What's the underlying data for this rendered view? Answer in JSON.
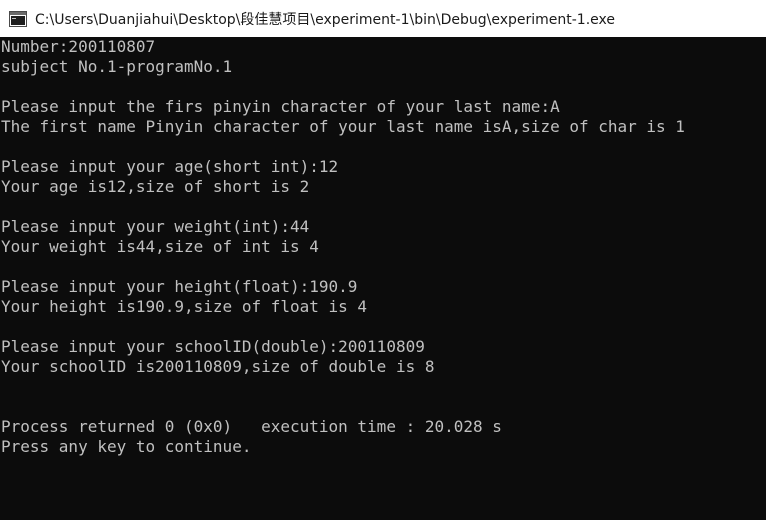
{
  "window": {
    "title": "C:\\Users\\Duanjiahui\\Desktop\\段佳慧项目\\experiment-1\\bin\\Debug\\experiment-1.exe",
    "icon": "console-window-icon"
  },
  "console": {
    "lines": [
      "Number:200110807",
      "subject No.1-programNo.1",
      "",
      "Please input the firs pinyin character of your last name:A",
      "The first name Pinyin character of your last name isA,size of char is 1",
      "",
      "Please input your age(short int):12",
      "Your age is12,size of short is 2",
      "",
      "Please input your weight(int):44",
      "Your weight is44,size of int is 4",
      "",
      "Please input your height(float):190.9",
      "Your height is190.9,size of float is 4",
      "",
      "Please input your schoolID(double):200110809",
      "Your schoolID is200110809,size of double is 8",
      "",
      "",
      "Process returned 0 (0x0)   execution time : 20.028 s",
      "Press any key to continue."
    ]
  }
}
